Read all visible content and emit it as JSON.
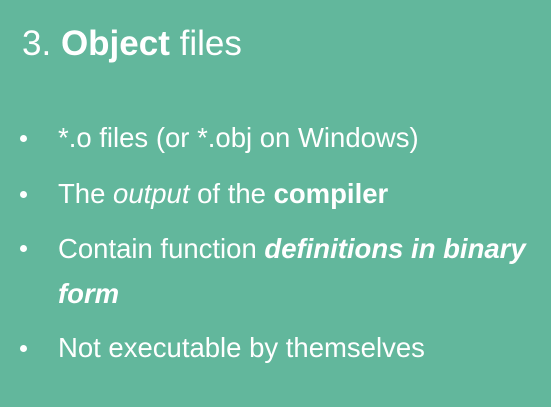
{
  "slide": {
    "background_color": "#62b79c",
    "text_color": "#ffffff",
    "title": {
      "number": "3.",
      "bold_word": "Object",
      "rest": "files"
    },
    "bullets": [
      {
        "text": "*.o files (or *.obj on Windows)"
      },
      {
        "part1": "The",
        "italic": "output",
        "part2": "of the",
        "bold": "compiler"
      },
      {
        "part1": "Contain function",
        "bold_italic": "definitions in binary form"
      },
      {
        "text": "Not executable by themselves"
      }
    ]
  }
}
